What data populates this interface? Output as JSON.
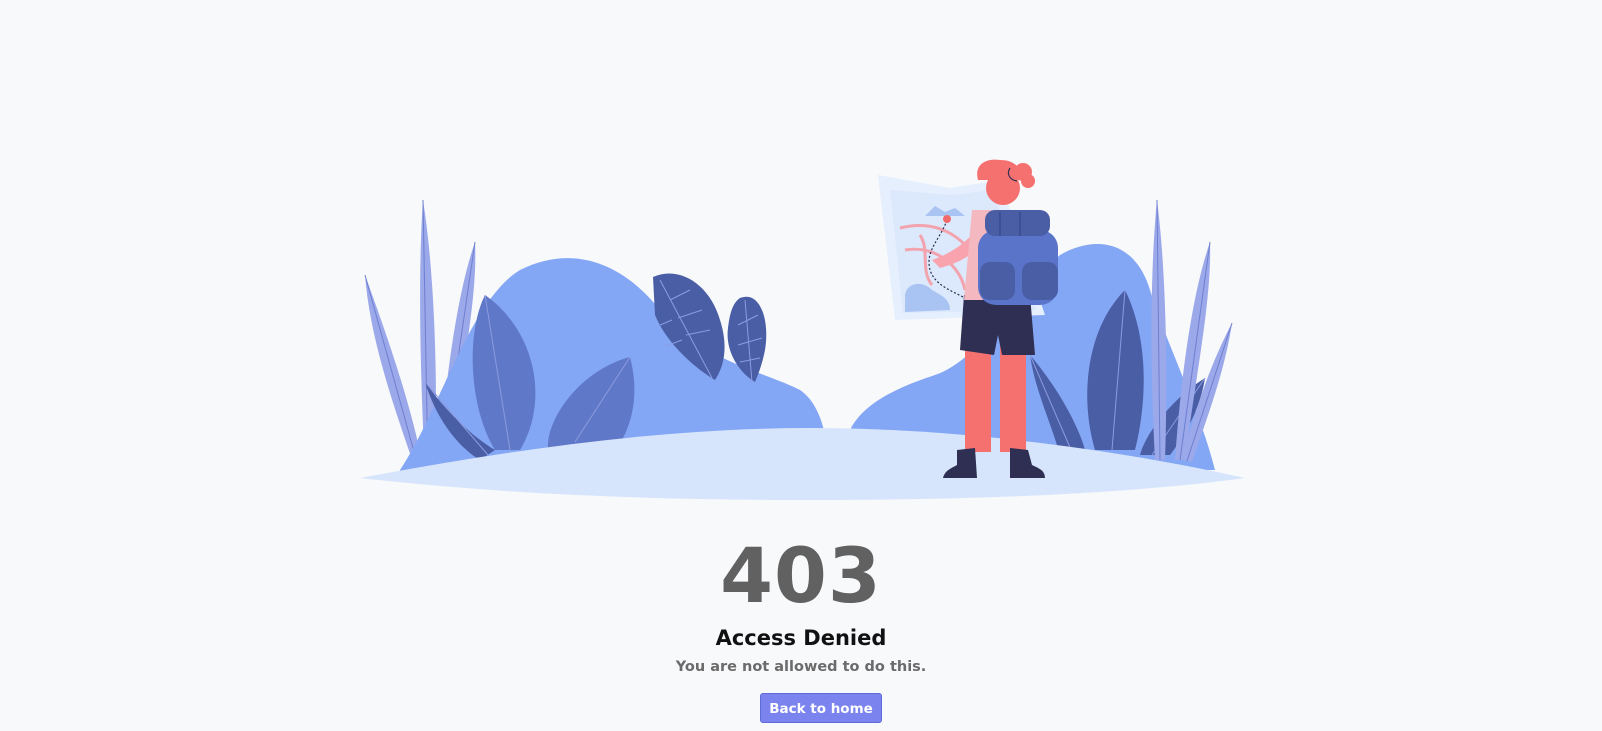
{
  "error": {
    "code": "403",
    "title": "Access Denied",
    "message": "You are not allowed to do this."
  },
  "actions": {
    "home_label": "Back to home"
  },
  "illustration": {
    "subject": "hiker-with-map-illustration",
    "colors": {
      "ground": "#d6e5fc",
      "bush": "#84a7f5",
      "leaf_dark": "#4a5ea6",
      "leaf_mid": "#5f78c8",
      "leaf_light": "#9ba8ea",
      "skin": "#f8a3ae",
      "hair": "#f57170",
      "backpack": "#5974c8",
      "shorts": "#2e2f53"
    }
  },
  "theme": {
    "background": "#f8f9fb",
    "accent": "#7b84ee",
    "text_muted": "#616161"
  }
}
